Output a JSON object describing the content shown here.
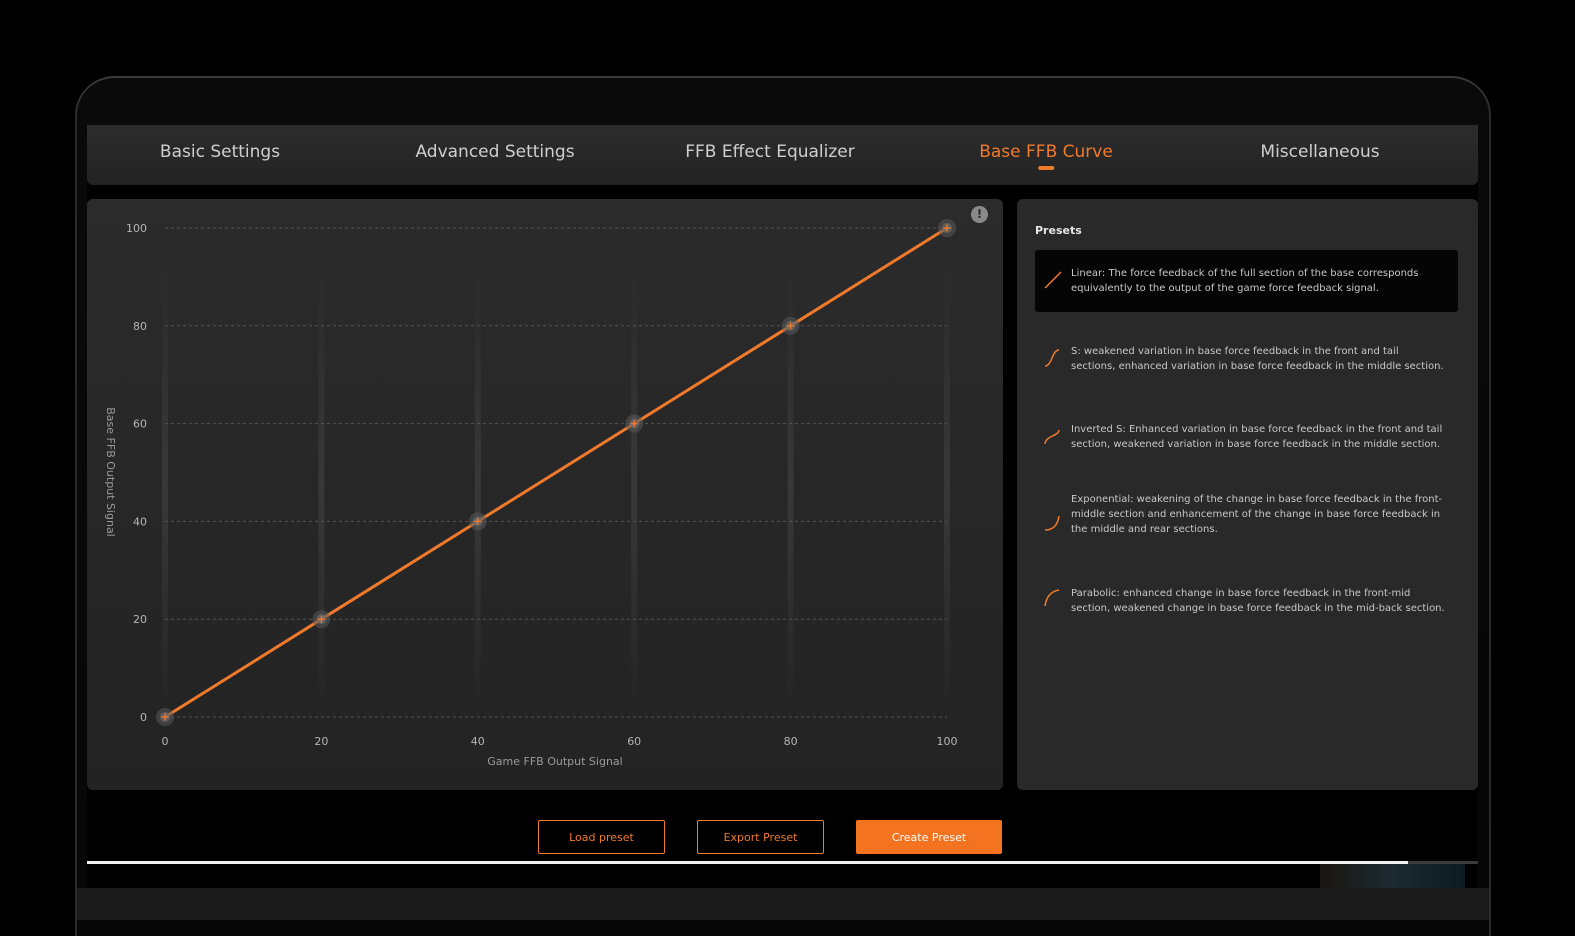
{
  "tabs": [
    {
      "label": "Basic Settings",
      "active": false
    },
    {
      "label": "Advanced Settings",
      "active": false
    },
    {
      "label": "FFB Effect Equalizer",
      "active": false
    },
    {
      "label": "Base FFB Curve",
      "active": true
    },
    {
      "label": "Miscellaneous",
      "active": false
    }
  ],
  "info_icon": "info-icon",
  "chart_data": {
    "type": "line",
    "xlabel": "Game FFB Output Signal",
    "ylabel": "Base FFB Output Signal",
    "xlim": [
      0,
      100
    ],
    "ylim": [
      0,
      100
    ],
    "x_ticks": [
      "0",
      "20",
      "40",
      "60",
      "80",
      "100"
    ],
    "y_ticks": [
      "0",
      "20",
      "40",
      "60",
      "80",
      "100"
    ],
    "grid": true,
    "series": [
      {
        "x": [
          0,
          20,
          40,
          60,
          80,
          100
        ],
        "y": [
          0,
          20,
          40,
          60,
          80,
          100
        ],
        "color": "#f07a2c"
      }
    ]
  },
  "presets": {
    "title": "Presets",
    "items": [
      {
        "label": "Linear: The force feedback of the full section of the base corresponds equivalently to the output of the game force feedback signal.",
        "icon": "linear-curve-icon",
        "selected": true
      },
      {
        "label": "S: weakened variation in base force feedback in the front and tail sections, enhanced variation in base force feedback in the middle section.",
        "icon": "s-curve-icon",
        "selected": false
      },
      {
        "label": "Inverted S: Enhanced variation in base force feedback in the front and tail section, weakened variation in base force feedback in the middle section.",
        "icon": "inverted-s-curve-icon",
        "selected": false
      },
      {
        "label": "Exponential: weakening of the change in base force feedback in the front-middle section and enhancement of the change in base force feedback in the middle and rear sections.",
        "icon": "exponential-curve-icon",
        "selected": false
      },
      {
        "label": "Parabolic: enhanced change in base force feedback in the front-mid section, weakened change in base force feedback in the mid-back section.",
        "icon": "parabolic-curve-icon",
        "selected": false
      }
    ]
  },
  "buttons": {
    "load": "Load preset",
    "export": "Export Preset",
    "create": "Create Preset"
  },
  "accent_color": "#f07a2c",
  "progress": 0.95
}
